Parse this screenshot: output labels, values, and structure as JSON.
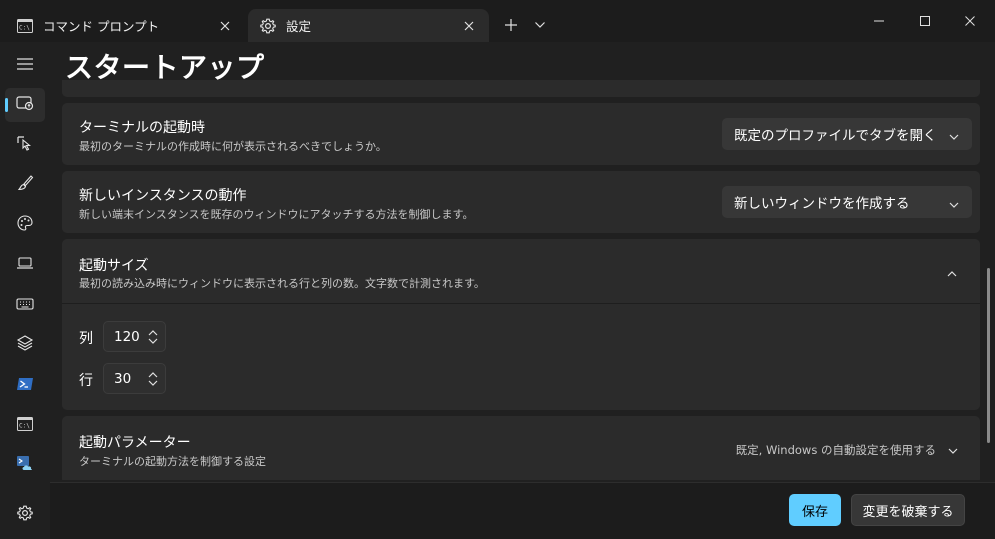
{
  "tabs": [
    {
      "label": "コマンド プロンプト",
      "icon": "cmd-icon"
    },
    {
      "label": "設定",
      "icon": "gear-icon"
    }
  ],
  "titlebar": {
    "new_tab": "new-tab-plus-icon",
    "dropdown": "chevron-down-icon"
  },
  "window_controls": [
    "minimize-icon",
    "maximize-icon",
    "close-icon"
  ],
  "nav": {
    "selected_index": 0,
    "items": [
      "startup-icon",
      "interaction-icon",
      "appearance-icon",
      "color-schemes-icon",
      "rendering-icon",
      "actions-icon",
      "profiles-defaults-icon",
      "powershell-icon",
      "cmd-profile-icon",
      "azure-cloud-shell-icon"
    ]
  },
  "page_title": "スタートアップ",
  "settings": {
    "launch_on_startup": {
      "title": "ターミナルの起動時",
      "description": "最初のターミナルの作成時に何が表示されるべきでしょうか。",
      "value": "既定のプロファイルでタブを開く"
    },
    "new_instance": {
      "title": "新しいインスタンスの動作",
      "description": "新しい端末インスタンスを既存のウィンドウにアタッチする方法を制御します。",
      "value": "新しいウィンドウを作成する"
    },
    "launch_size": {
      "title": "起動サイズ",
      "description": "最初の読み込み時にウィンドウに表示される行と列の数。文字数で計測されます。",
      "columns_label": "列",
      "columns_value": "120",
      "rows_label": "行",
      "rows_value": "30"
    },
    "launch_parameters": {
      "title": "起動パラメーター",
      "description": "ターミナルの起動方法を制御する設定",
      "summary": "既定, Windows の自動設定を使用する"
    }
  },
  "footer": {
    "save": "保存",
    "discard": "変更を破棄する"
  },
  "colors": {
    "accent": "#60cdff",
    "background": "#202020",
    "card": "#2b2b2b",
    "titlebar": "#1c1c1c"
  }
}
